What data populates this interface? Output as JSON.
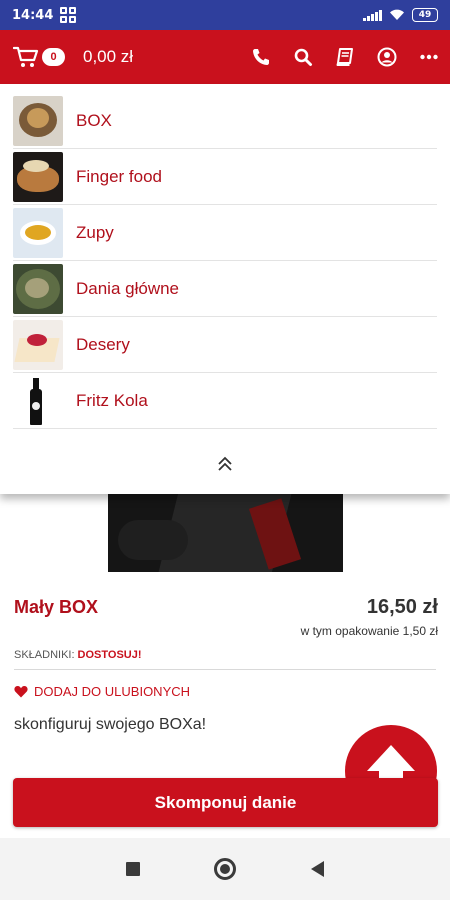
{
  "status_bar": {
    "time": "14:44",
    "battery": "49"
  },
  "app_bar": {
    "cart_count": "0",
    "cart_total": "0,00 zł",
    "icons": [
      "phone-icon",
      "search-icon",
      "book-icon",
      "account-icon",
      "more-icon"
    ]
  },
  "menu": {
    "categories": [
      {
        "label": "BOX",
        "thumb": "box-thumbnail"
      },
      {
        "label": "Finger food",
        "thumb": "finger-food-thumbnail"
      },
      {
        "label": "Zupy",
        "thumb": "soup-thumbnail"
      },
      {
        "label": "Dania główne",
        "thumb": "main-dish-thumbnail"
      },
      {
        "label": "Desery",
        "thumb": "dessert-thumbnail"
      },
      {
        "label": "Fritz Kola",
        "thumb": "fritz-kola-bottle-thumbnail"
      }
    ],
    "collapse_icon": "chevron-double-up-icon"
  },
  "product": {
    "name": "Mały BOX",
    "price": "16,50 zł",
    "packaging_note": "w tym opakowanie 1,50 zł",
    "ingredients_label": "SKŁADNIKI:",
    "customize_link": "DOSTOSUJ!",
    "favorite_label": "DODAJ DO ULUBIONYCH",
    "description": "skonfiguruj swojego BOXa!",
    "cta_label": "Skomponuj danie"
  },
  "colors": {
    "brand_red": "#c9111d",
    "status_bar": "#2f3f9d",
    "text_dark": "#333333"
  }
}
